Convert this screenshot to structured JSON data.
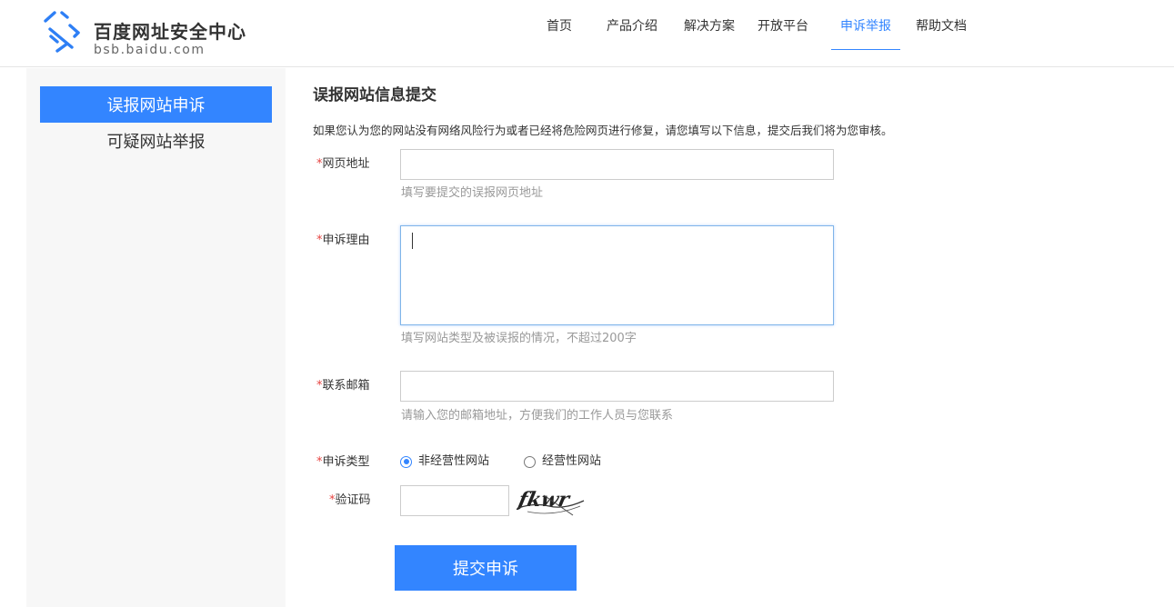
{
  "header": {
    "logo_title": "百度网址安全中心",
    "logo_sub": "bsb.baidu.com",
    "nav": [
      {
        "label": "首页"
      },
      {
        "label": "产品介绍"
      },
      {
        "label": "解决方案"
      },
      {
        "label": "开放平台"
      },
      {
        "label": "申诉举报",
        "active": true
      },
      {
        "label": "帮助文档"
      }
    ]
  },
  "sidebar": {
    "items": [
      {
        "label": "误报网站申诉",
        "active": true
      },
      {
        "label": "可疑网站举报",
        "active": false
      }
    ]
  },
  "form": {
    "title": "误报网站信息提交",
    "description": "如果您认为您的网站没有网络风险行为或者已经将危险网页进行修复，请您填写以下信息，提交后我们将为您审核。",
    "required_mark": "*",
    "url": {
      "label": "网页地址",
      "value": "",
      "hint": "填写要提交的误报网页地址"
    },
    "reason": {
      "label": "申诉理由",
      "value": "",
      "hint": "填写网站类型及被误报的情况，不超过200字"
    },
    "email": {
      "label": "联系邮箱",
      "value": "",
      "hint": "请输入您的邮箱地址，方便我们的工作人员与您联系"
    },
    "type": {
      "label": "申诉类型",
      "options": [
        {
          "label": "非经营性网站",
          "checked": true
        },
        {
          "label": "经营性网站",
          "checked": false
        }
      ]
    },
    "captcha": {
      "label": "验证码",
      "value": "",
      "image_text": "fkwr"
    },
    "submit_label": "提交申诉"
  },
  "colors": {
    "accent": "#3385ff",
    "required": "#e64340",
    "hint": "#999999",
    "logo_blue": "#2e7ff5"
  },
  "icons": {
    "logo": "baidu-security-logo-icon",
    "captcha": "captcha-image"
  }
}
